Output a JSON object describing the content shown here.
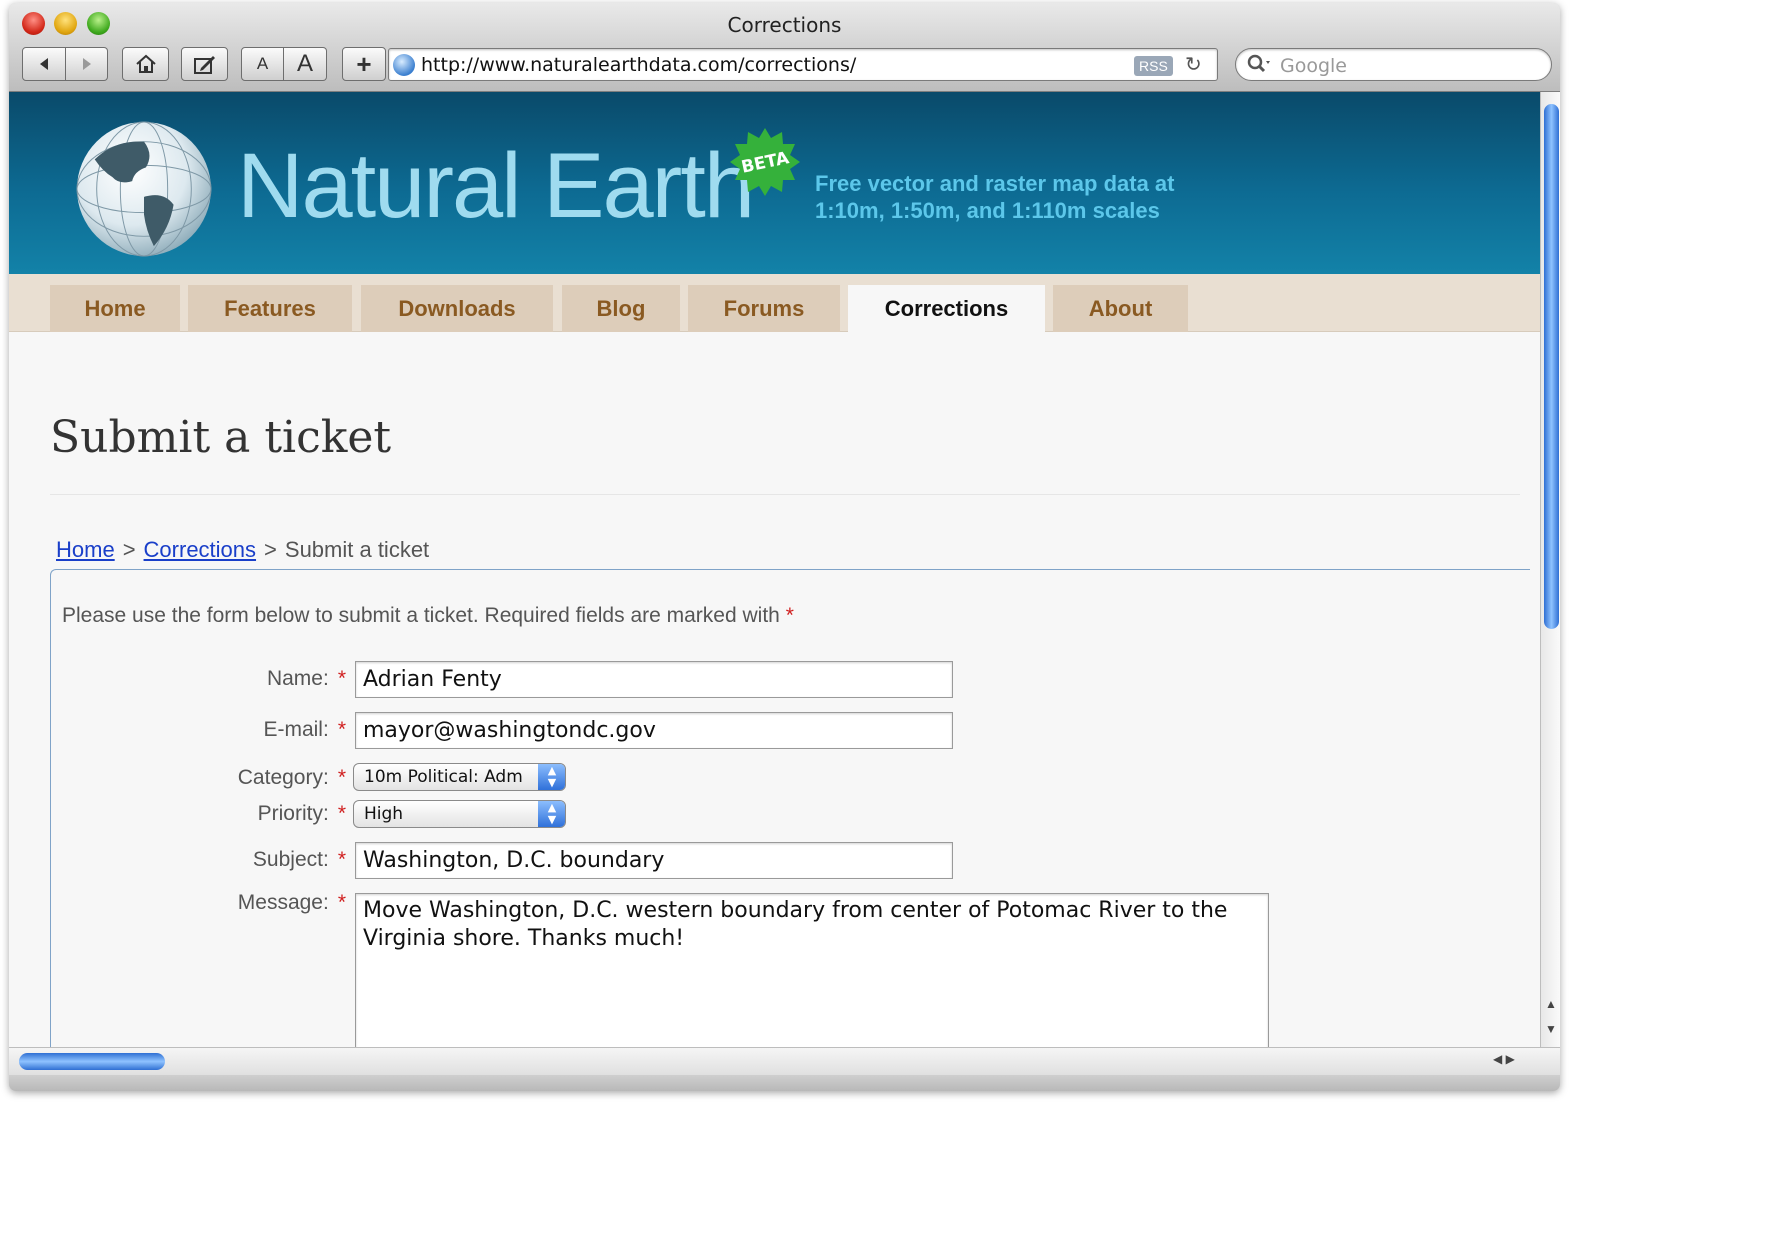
{
  "window": {
    "title": "Corrections"
  },
  "toolbar": {
    "back_icon": "back-arrow-icon",
    "forward_icon": "forward-arrow-icon",
    "home_icon": "home-icon",
    "edit_icon": "edit-icon",
    "text_smaller_label": "A",
    "text_larger_label": "A",
    "add_bookmark_label": "+",
    "url": "http://www.naturalearthdata.com/corrections/",
    "rss_label": "RSS",
    "search_placeholder": "Google"
  },
  "site": {
    "logo_text": "Natural Earth",
    "beta_label": "BETA",
    "tagline_line1": "Free vector and raster map data at",
    "tagline_line2": "1:10m, 1:50m, and 1:110m scales",
    "nav": [
      {
        "label": "Home"
      },
      {
        "label": "Features"
      },
      {
        "label": "Downloads"
      },
      {
        "label": "Blog"
      },
      {
        "label": "Forums"
      },
      {
        "label": "Corrections",
        "active": true
      },
      {
        "label": "About"
      }
    ]
  },
  "page": {
    "title": "Submit a ticket",
    "breadcrumb": {
      "home": "Home",
      "separator": ">",
      "corrections": "Corrections",
      "current": "Submit a ticket"
    },
    "intro": "Please use the form below to submit a ticket. Required fields are marked with",
    "required_mark": "*"
  },
  "form": {
    "name_label": "Name:",
    "name_value": "Adrian Fenty",
    "email_label": "E-mail:",
    "email_value": "mayor@washingtondc.gov",
    "category_label": "Category:",
    "category_value": "10m Political: Adm",
    "priority_label": "Priority:",
    "priority_value": "High",
    "subject_label": "Subject:",
    "subject_value": "Washington, D.C. boundary",
    "message_label": "Message:",
    "message_line1": "Move Washington, D.C. western boundary from center of Potomac River to the",
    "message_line2": "Virginia shore. Thanks much!"
  },
  "colors": {
    "banner": "#0d6b93",
    "logo": "#9fdbef",
    "tagline": "#5cc7ea",
    "nav_text": "#8a5a22",
    "link": "#1a3fc9",
    "required": "#d02020"
  }
}
